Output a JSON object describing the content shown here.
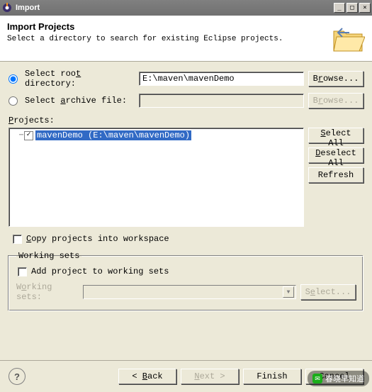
{
  "window": {
    "title": "Import"
  },
  "header": {
    "title": "Import Projects",
    "desc": "Select a directory to search for existing Eclipse projects."
  },
  "source": {
    "rootLabel": "Select root directory:",
    "rootUnderline": "t",
    "archiveLabel": "Select archive file:",
    "archiveUnderline": "a",
    "rootPath": "E:\\maven\\mavenDemo",
    "archivePath": "",
    "browseLabel": "Browse...",
    "rootSelected": true
  },
  "projects": {
    "label": "Projects:",
    "items": [
      {
        "label": "mavenDemo (E:\\maven\\mavenDemo)",
        "checked": true,
        "selected": true
      }
    ],
    "selectAll": "Select All",
    "deselectAll": "Deselect All",
    "refresh": "Refresh"
  },
  "copy": {
    "label": "Copy projects into workspace",
    "checked": false
  },
  "workingSets": {
    "legend": "Working sets",
    "addLabel": "Add project to working sets",
    "wsLabel": "Working sets:",
    "selectLabel": "Select...",
    "enabled": false
  },
  "footer": {
    "back": "< Back",
    "next": "Next >",
    "finish": "Finish",
    "cancel": "Cancel"
  },
  "watermark": "春晓早知道"
}
